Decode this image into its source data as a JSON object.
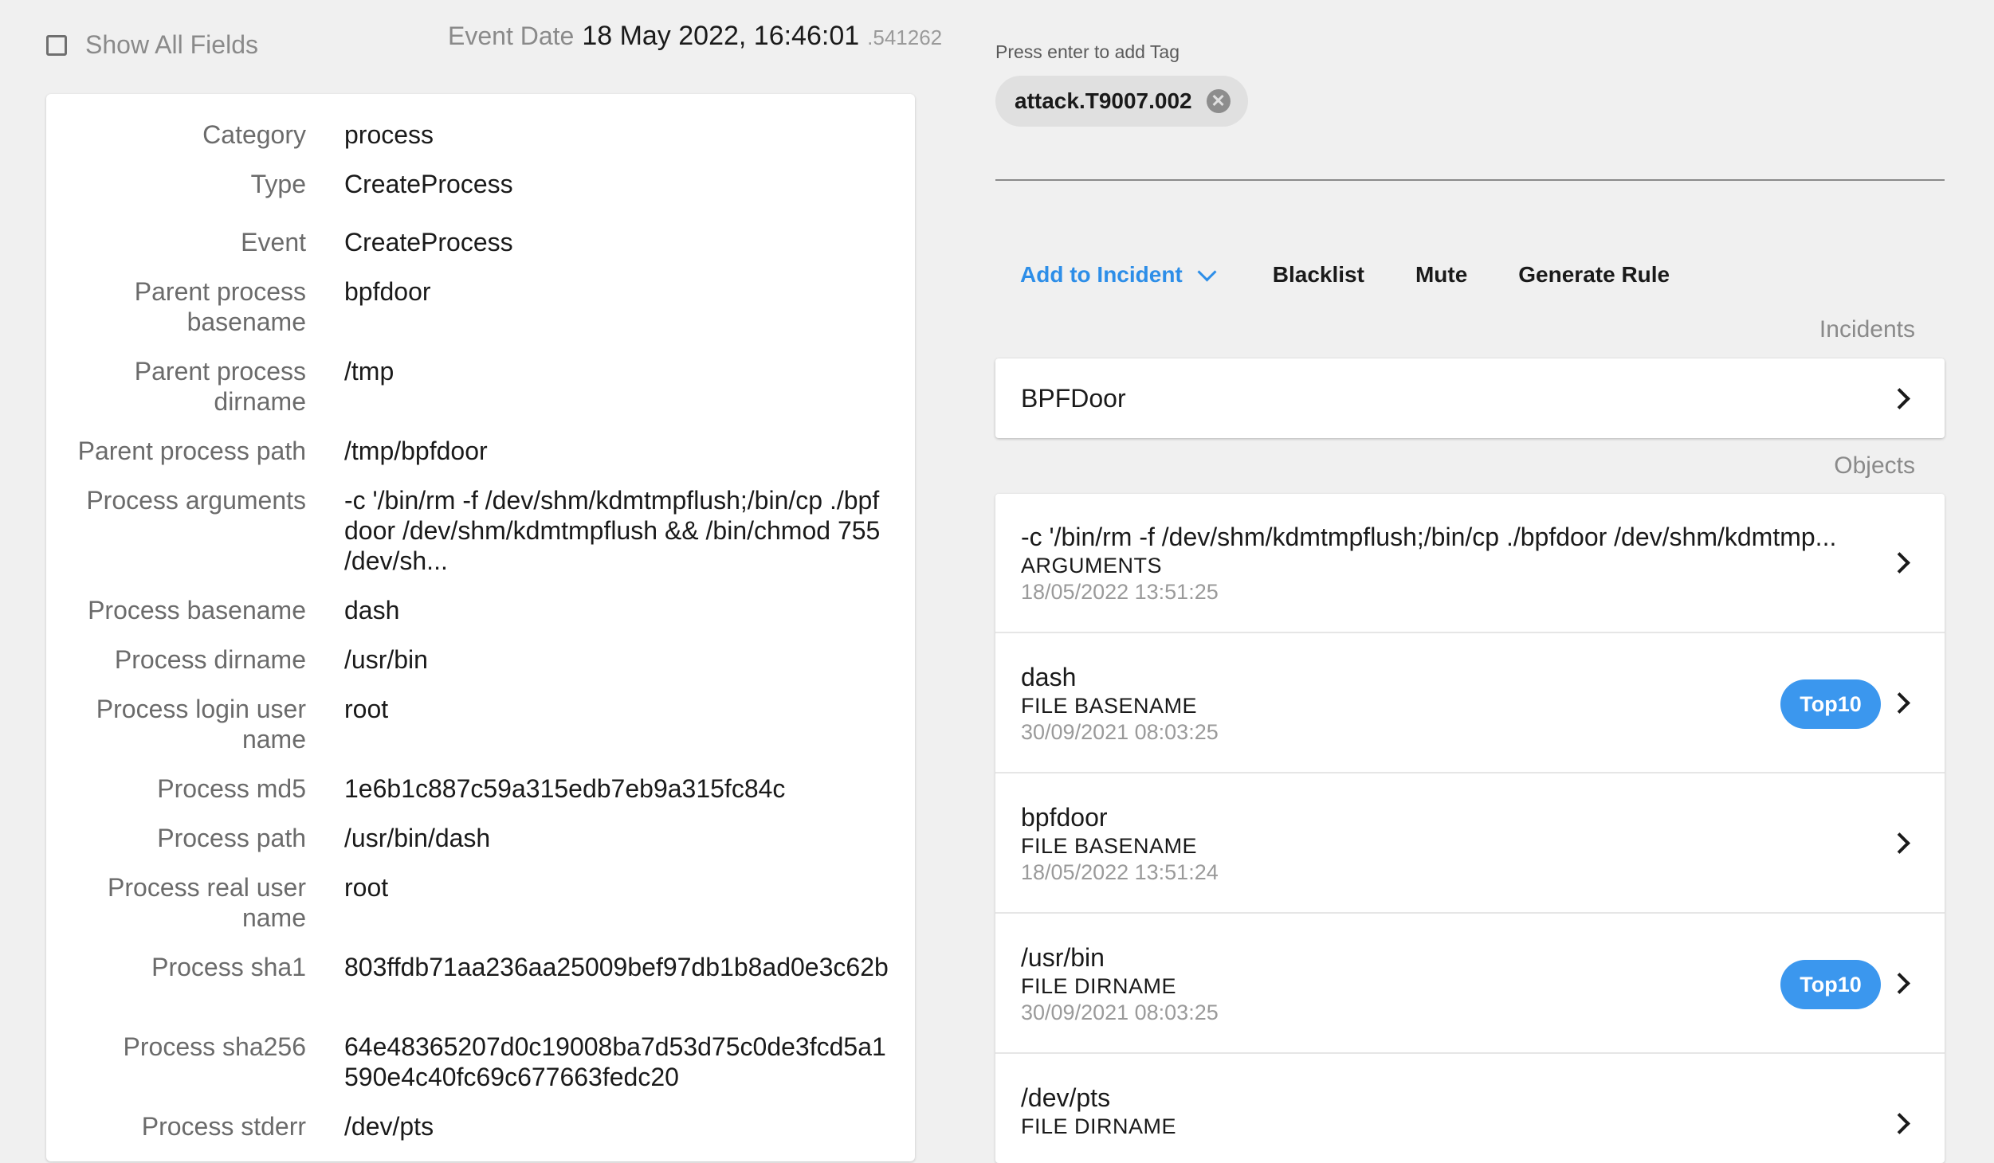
{
  "header": {
    "show_all_fields_label": "Show All Fields",
    "event_date_label": "Event Date",
    "event_date_value": "18 May 2022, 16:46:01",
    "event_date_micro": ".541262"
  },
  "fields": [
    {
      "label": "Category",
      "value": "process"
    },
    {
      "label": "Type",
      "value": "CreateProcess"
    },
    {
      "label": "Event",
      "value": "CreateProcess"
    },
    {
      "label": "Parent process basename",
      "value": "bpfdoor"
    },
    {
      "label": "Parent process dirname",
      "value": "/tmp"
    },
    {
      "label": "Parent process path",
      "value": "/tmp/bpfdoor"
    },
    {
      "label": "Process arguments",
      "value": "-c '/bin/rm -f /dev/shm/kdmtmpflush;/bin/cp ./bpfdoor /dev/shm/kdmtmpflush && /bin/chmod 755 /dev/sh..."
    },
    {
      "label": "Process basename",
      "value": "dash"
    },
    {
      "label": "Process dirname",
      "value": "/usr/bin"
    },
    {
      "label": "Process login user name",
      "value": "root"
    },
    {
      "label": "Process md5",
      "value": "1e6b1c887c59a315edb7eb9a315fc84c"
    },
    {
      "label": "Process path",
      "value": "/usr/bin/dash"
    },
    {
      "label": "Process real user name",
      "value": "root"
    },
    {
      "label": "Process sha1",
      "value": "803ffdb71aa236aa25009bef97db1b8ad0e3c62b"
    },
    {
      "label": "Process sha256",
      "value": "64e48365207d0c19008ba7d53d75c0de3fcd5a1590e4c40fc69c677663fedc20"
    },
    {
      "label": "Process stderr",
      "value": "/dev/pts"
    }
  ],
  "tags": {
    "hint": "Press enter to add Tag",
    "items": [
      {
        "label": "attack.T9007.002",
        "remove_icon": "close-circle-icon",
        "remove_glyph": "✕"
      }
    ]
  },
  "actions": {
    "add_to_incident": "Add to Incident",
    "blacklist": "Blacklist",
    "mute": "Mute",
    "generate_rule": "Generate Rule"
  },
  "incidents": {
    "title": "Incidents",
    "items": [
      {
        "name": "BPFDoor"
      }
    ]
  },
  "objects": {
    "title": "Objects",
    "items": [
      {
        "title": "-c '/bin/rm -f /dev/shm/kdmtmpflush;/bin/cp ./bpfdoor /dev/shm/kdmtmp...",
        "type": "ARGUMENTS",
        "date": "18/05/2022 13:51:25",
        "badge": ""
      },
      {
        "title": "dash",
        "type": "FILE BASENAME",
        "date": "30/09/2021 08:03:25",
        "badge": "Top10"
      },
      {
        "title": "bpfdoor",
        "type": "FILE BASENAME",
        "date": "18/05/2022 13:51:24",
        "badge": ""
      },
      {
        "title": "/usr/bin",
        "type": "FILE DIRNAME",
        "date": "30/09/2021 08:03:25",
        "badge": "Top10"
      },
      {
        "title": "/dev/pts",
        "type": "FILE DIRNAME",
        "date": "",
        "badge": ""
      }
    ]
  },
  "colors": {
    "accent": "#2d8ee8",
    "badge": "#3b97ee",
    "background": "#f0f0f0",
    "card": "#ffffff"
  }
}
